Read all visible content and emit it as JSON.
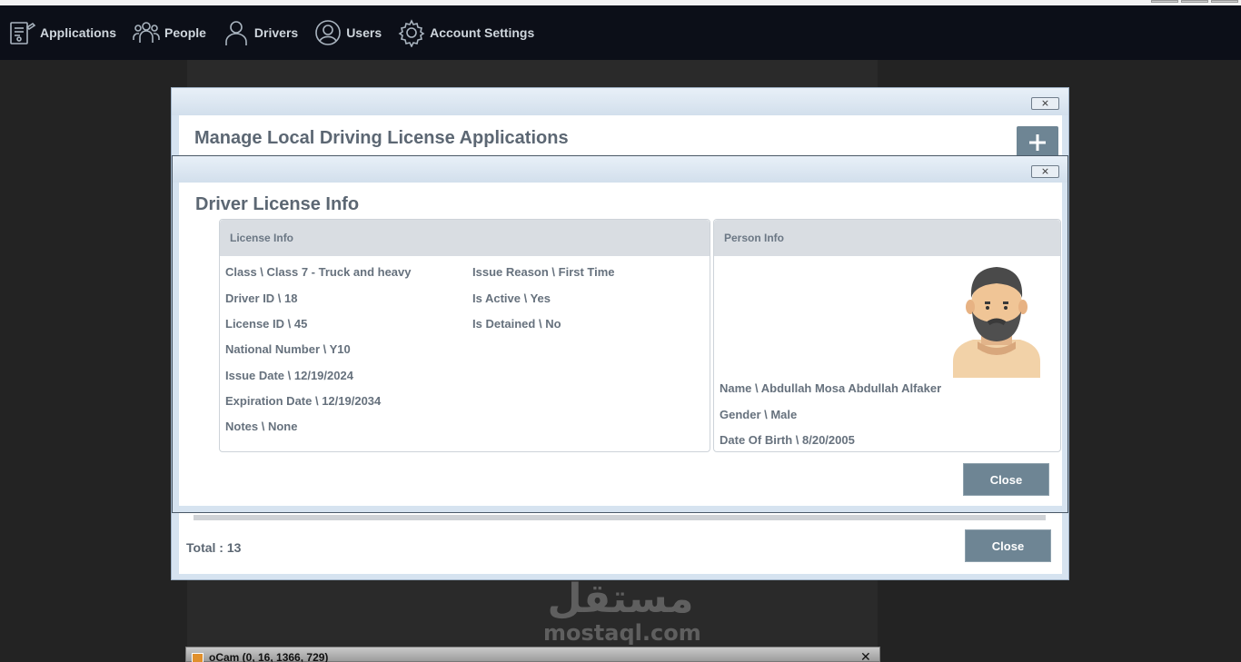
{
  "navbar": {
    "items": [
      {
        "label": "Applications",
        "icon": "applications-icon"
      },
      {
        "label": "People",
        "icon": "people-icon"
      },
      {
        "label": "Drivers",
        "icon": "driver-icon"
      },
      {
        "label": "Users",
        "icon": "user-circle-icon"
      },
      {
        "label": "Account Settings",
        "icon": "gear-icon"
      }
    ]
  },
  "outer_dialog": {
    "close_symbol": "⨯",
    "title": "Manage Local Driving License Applications",
    "add_symbol": "+",
    "total_label": "Total : 13",
    "close_label": "Close"
  },
  "license_dialog": {
    "close_symbol": "⨯",
    "title": "Driver License Info",
    "license_info": {
      "header": "License Info",
      "class": "Class \\  Class 7 - Truck and heavy",
      "driver_id": "Driver ID \\ 18",
      "license_id": "License ID \\  45",
      "national_number": "National Number \\  Y10",
      "issue_date": "Issue Date \\  12/19/2024",
      "expiration_date": "Expiration Date \\   12/19/2034",
      "notes": "Notes \\   None",
      "issue_reason": "Issue Reason \\   First Time",
      "is_active": "Is Active \\   Yes",
      "is_detained": "Is Detained \\  No"
    },
    "person_info": {
      "header": "Person Info",
      "name": "Name \\  Abdullah Mosa Abdullah Alfaker",
      "gender": "Gender \\  Male",
      "date_of_birth": "Date Of Birth \\  8/20/2005"
    },
    "close_label": "Close"
  },
  "watermark": {
    "arabic": "مستقل",
    "latin": "mostaql.com"
  },
  "ocam": {
    "title": "oCam (0, 16, 1366, 729)",
    "close_symbol": "✕"
  },
  "colors": {
    "navbar_bg": "#0c0f18",
    "button_bg": "#6e8594",
    "dialog_frame": "#d6e3f0",
    "text": "#66717d"
  }
}
